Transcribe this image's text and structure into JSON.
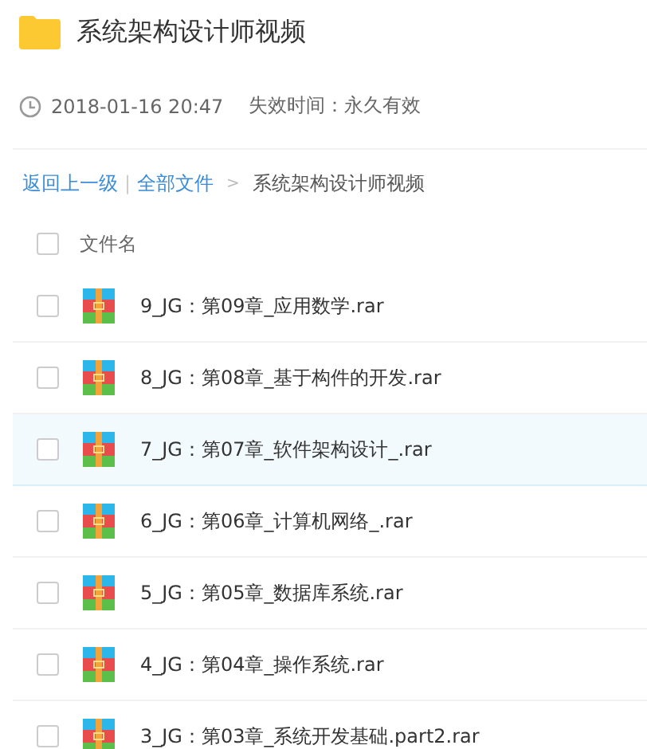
{
  "folder": {
    "title": "系统架构设计师视频"
  },
  "meta": {
    "date": "2018-01-16 20:47",
    "expiry": "失效时间：永久有效"
  },
  "breadcrumb": {
    "back": "返回上一级",
    "separator": "|",
    "root": "全部文件",
    "arrow": ">",
    "current": "系统架构设计师视频"
  },
  "table": {
    "header": {
      "label": "文件名",
      "checked": false
    },
    "rows": [
      {
        "name": "9_JG：第09章_应用数学.rar",
        "checked": false,
        "selected": false
      },
      {
        "name": "8_JG：第08章_基于构件的开发.rar",
        "checked": false,
        "selected": false
      },
      {
        "name": "7_JG：第07章_软件架构设计_.rar",
        "checked": false,
        "selected": true
      },
      {
        "name": "6_JG：第06章_计算机网络_.rar",
        "checked": false,
        "selected": false
      },
      {
        "name": "5_JG：第05章_数据库系统.rar",
        "checked": false,
        "selected": false
      },
      {
        "name": "4_JG：第04章_操作系统.rar",
        "checked": false,
        "selected": false
      },
      {
        "name": "3_JG：第03章_系统开发基础.part2.rar",
        "checked": false,
        "selected": false
      }
    ]
  }
}
